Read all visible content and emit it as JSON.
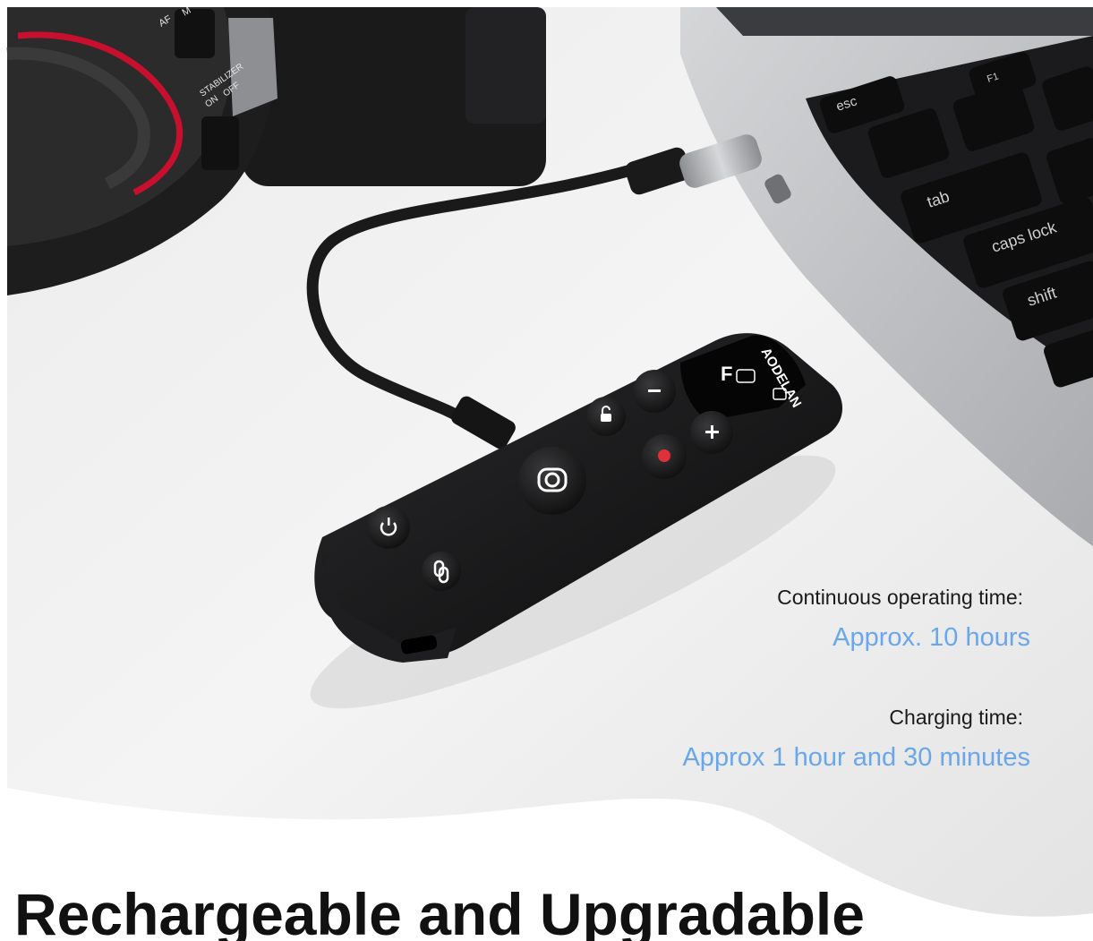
{
  "product": {
    "brand_logo": "AODELAN",
    "screen_mode_letter": "F"
  },
  "laptop_keys": [
    "esc",
    "tab",
    "caps lock",
    "shift",
    "F1"
  ],
  "camera_labels": [
    "AF",
    "M",
    "STABILIZER",
    "ON",
    "OFF"
  ],
  "specs": [
    {
      "label": "Continuous operating time:",
      "value": "Approx. 10 hours"
    },
    {
      "label": "Charging time:",
      "value": "Approx 1 hour and 30 minutes"
    }
  ],
  "headline": "Rechargeable and Upgradable",
  "colors": {
    "accent_value": "#6aa7ea",
    "record_dot": "#e0313b",
    "lens_ring": "#c8102e"
  }
}
